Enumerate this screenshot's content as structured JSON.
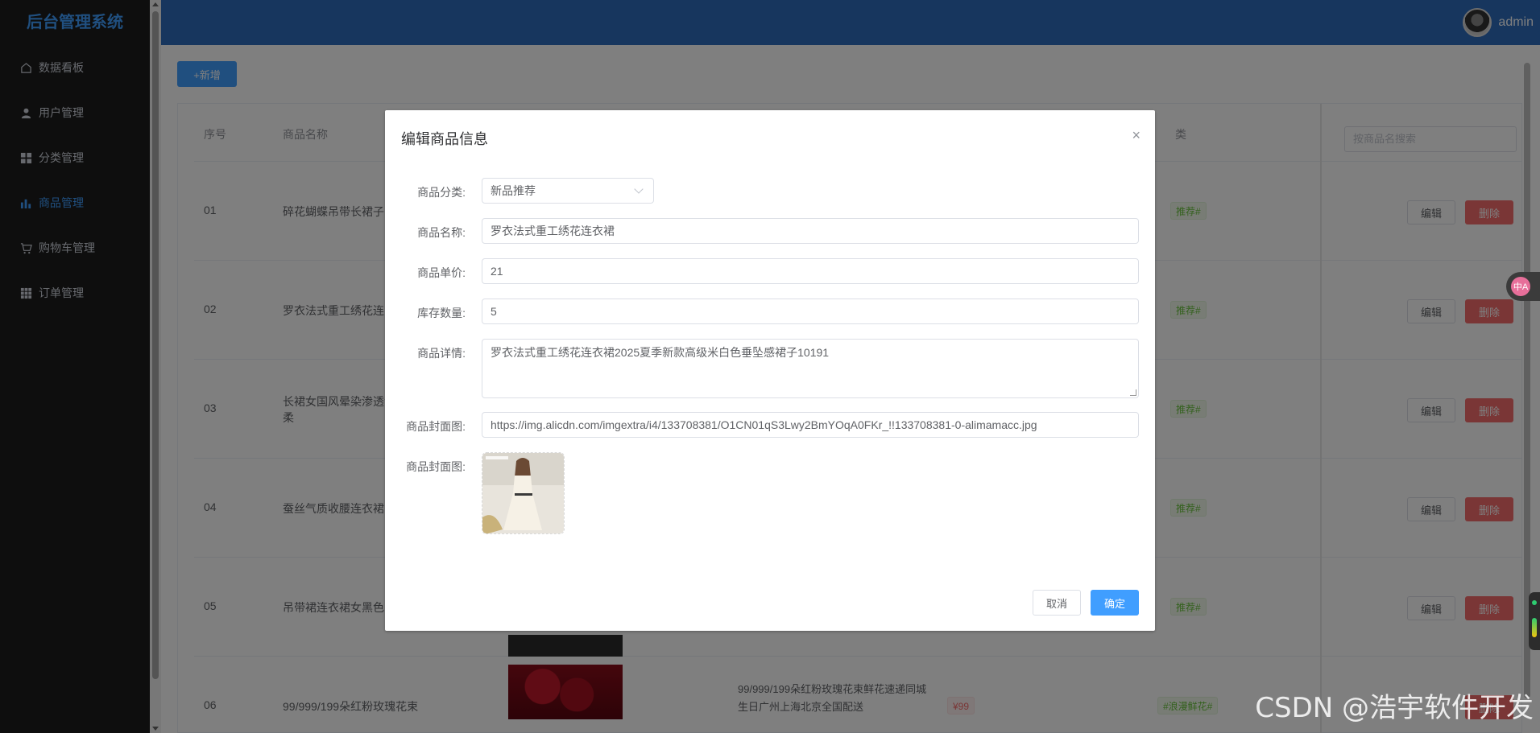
{
  "sidebar": {
    "title": "后台管理系统",
    "items": [
      {
        "label": "数据看板",
        "icon": "home-icon"
      },
      {
        "label": "用户管理",
        "icon": "user-icon"
      },
      {
        "label": "分类管理",
        "icon": "grid-icon"
      },
      {
        "label": "商品管理",
        "icon": "bar-chart-icon"
      },
      {
        "label": "购物车管理",
        "icon": "cart-icon"
      },
      {
        "label": "订单管理",
        "icon": "apps-icon"
      }
    ],
    "active_index": 3
  },
  "header": {
    "username": "admin"
  },
  "toolbar": {
    "add_label": "+新增"
  },
  "table": {
    "headers": {
      "index": "序号",
      "name": "商品名称",
      "category": "类"
    },
    "search_placeholder": "按商品名搜索",
    "edit_label": "编辑",
    "delete_label": "删除",
    "rows": [
      {
        "index": "01",
        "name": "碎花蝴蝶吊带长裙子",
        "tag": "推荐#"
      },
      {
        "index": "02",
        "name": "罗衣法式重工绣花连",
        "tag": "推荐#"
      },
      {
        "index": "03",
        "name": "长裙女国风晕染渗透温柔",
        "tag": "推荐#"
      },
      {
        "index": "04",
        "name": "蚕丝气质收腰连衣裙",
        "tag": "推荐#"
      },
      {
        "index": "05",
        "name": "吊带裙连衣裙女黑色",
        "tag": "推荐#"
      },
      {
        "index": "06",
        "name": "99/999/199朵红粉玫瑰花束",
        "desc": "99/999/199朵红粉玫瑰花束鲜花速递同城生日广州上海北京全国配送",
        "price": "¥99",
        "tag": "#浪漫鲜花#"
      }
    ]
  },
  "dialog": {
    "title": "编辑商品信息",
    "close": "×",
    "fields": {
      "category": {
        "label": "商品分类:",
        "value": "新品推荐"
      },
      "name": {
        "label": "商品名称:",
        "value": "罗衣法式重工绣花连衣裙"
      },
      "price": {
        "label": "商品单价:",
        "value": "21"
      },
      "stock": {
        "label": "库存数量:",
        "value": "5"
      },
      "detail": {
        "label": "商品详情:",
        "value": "罗衣法式重工绣花连衣裙2025夏季新款高级米白色垂坠感裙子10191"
      },
      "cover_url": {
        "label": "商品封面图:",
        "value": "https://img.alicdn.com/imgextra/i4/133708381/O1CN01qS3Lwy2BmYOqA0FKr_!!133708381-0-alimamacc.jpg"
      },
      "cover_preview": {
        "label": "商品封面图:"
      }
    },
    "cancel_label": "取消",
    "ok_label": "确定"
  },
  "widgets": {
    "translate_label": "中A"
  },
  "watermark": "CSDN @浩宇软件开发",
  "colors": {
    "primary": "#409eff",
    "header": "#2e6cbd",
    "sidebar": "#1c1c1c",
    "danger": "#f56c6c"
  }
}
